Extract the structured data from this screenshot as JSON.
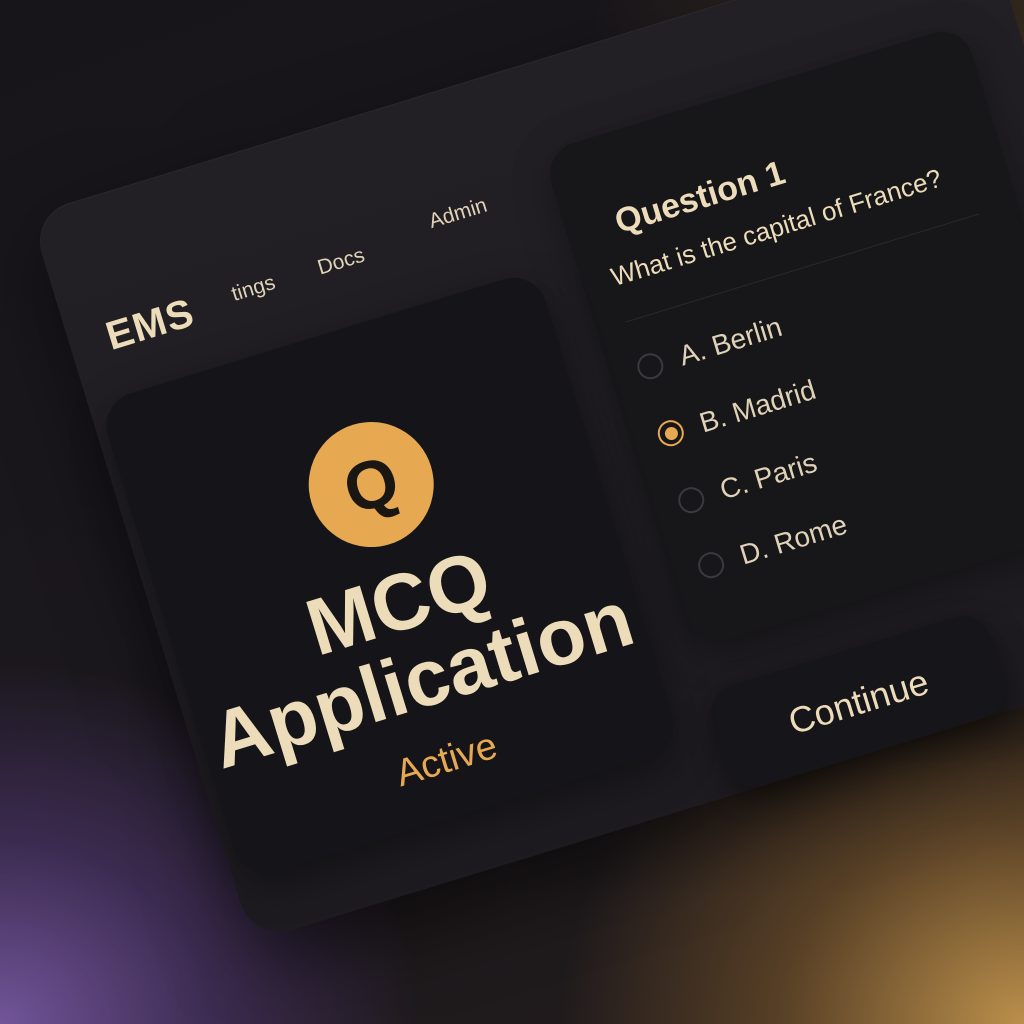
{
  "app": {
    "brand": "EMS",
    "accent_color": "#e6a952",
    "text_color": "#eddcb9"
  },
  "nav": {
    "items": [
      {
        "label": "tings"
      },
      {
        "label": "Docs"
      },
      {
        "label": "Admin"
      }
    ]
  },
  "app_card": {
    "badge_letter": "Q",
    "title_line1": "MCQ",
    "title_line2": "Application",
    "status": "Active"
  },
  "question": {
    "title": "Question 1",
    "text": "What is the capital of France?",
    "options": [
      {
        "label": "A. Berlin",
        "selected": false
      },
      {
        "label": "B. Madrid",
        "selected": true
      },
      {
        "label": "C. Paris",
        "selected": false
      },
      {
        "label": "D. Rome",
        "selected": false
      }
    ]
  },
  "actions": {
    "continue_label": "Continue"
  }
}
